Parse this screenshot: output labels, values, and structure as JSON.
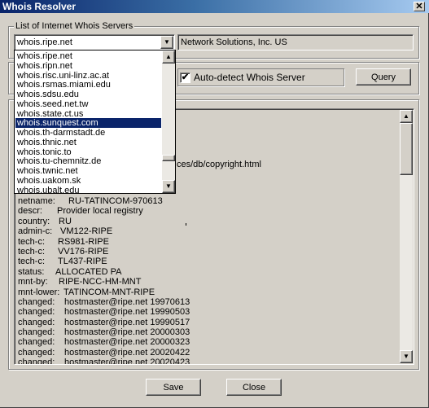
{
  "window": {
    "title": "Whois Resolver",
    "close_glyph": "✕"
  },
  "servers_group": {
    "legend": "List of Internet Whois Servers",
    "selected_server": "whois.ripe.net",
    "server_info": "Network Solutions, Inc. US",
    "dropdown_items": [
      {
        "label": "whois.ripe.net",
        "selected": false
      },
      {
        "label": "whois.ripn.net",
        "selected": false
      },
      {
        "label": "whois.risc.uni-linz.ac.at",
        "selected": false
      },
      {
        "label": "whois.rsmas.miami.edu",
        "selected": false
      },
      {
        "label": "whois.sdsu.edu",
        "selected": false
      },
      {
        "label": "whois.seed.net.tw",
        "selected": false
      },
      {
        "label": "whois.state.ct.us",
        "selected": false
      },
      {
        "label": "whois.sunquest.com",
        "selected": true
      },
      {
        "label": "whois.th-darmstadt.de",
        "selected": false
      },
      {
        "label": "whois.thnic.net",
        "selected": false
      },
      {
        "label": "whois.tonic.to",
        "selected": false
      },
      {
        "label": "whois.tu-chemnitz.de",
        "selected": false
      },
      {
        "label": "whois.twnic.net",
        "selected": false
      },
      {
        "label": "whois.uakom.sk",
        "selected": false
      },
      {
        "label": "whois.ubalt.edu",
        "selected": false
      }
    ]
  },
  "query_group": {
    "auto_detect_label": "Auto-detect Whois Server",
    "auto_detect_checked": true,
    "check_glyph": "✔",
    "query_button": "Query"
  },
  "result": {
    "partial_line": "ces/db/copyright.html",
    "lines": [
      {
        "key": "netname:",
        "value": "RU-TATINCOM-970613",
        "indent": 1
      },
      {
        "key": "descr:",
        "value": "Provider local registry",
        "indent": 0
      },
      {
        "key": "country:",
        "value": "RU",
        "indent": 0
      },
      {
        "key": "admin-c:",
        "value": "VM122-RIPE",
        "indent": 0
      },
      {
        "key": "tech-c:",
        "value": "RS981-RIPE",
        "indent": 0
      },
      {
        "key": "tech-c:",
        "value": "VV176-RIPE",
        "indent": 0
      },
      {
        "key": "tech-c:",
        "value": "TL437-RIPE",
        "indent": 0
      },
      {
        "key": "status:",
        "value": "ALLOCATED PA",
        "indent": 0
      },
      {
        "key": "mnt-by:",
        "value": "RIPE-NCC-HM-MNT",
        "indent": 0
      },
      {
        "key": "mnt-lower:",
        "value": "TATINCOM-MNT-RIPE",
        "indent": 0
      },
      {
        "key": "changed:",
        "value": "hostmaster@ripe.net 19970613",
        "indent": 0
      },
      {
        "key": "changed:",
        "value": "hostmaster@ripe.net 19990503",
        "indent": 0
      },
      {
        "key": "changed:",
        "value": "hostmaster@ripe.net 19990517",
        "indent": 0
      },
      {
        "key": "changed:",
        "value": "hostmaster@ripe.net 20000303",
        "indent": 0
      },
      {
        "key": "changed:",
        "value": "hostmaster@ripe.net 20000323",
        "indent": 0
      },
      {
        "key": "changed:",
        "value": "hostmaster@ripe.net 20020422",
        "indent": 0
      },
      {
        "key": "changed:",
        "value": "hostmaster@ripe.net 20020423",
        "indent": 0
      }
    ]
  },
  "footer": {
    "save_button": "Save",
    "close_button": "Close"
  },
  "scroll_glyphs": {
    "up": "▲",
    "down": "▼"
  }
}
